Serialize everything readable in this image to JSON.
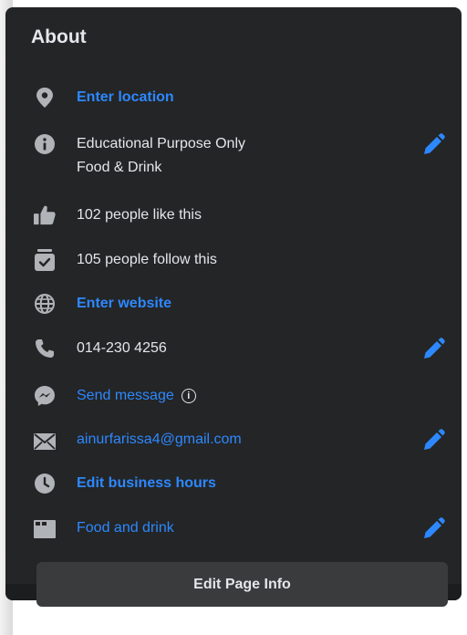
{
  "about": {
    "title": "About",
    "location": "Enter location",
    "category_line1": "Educational Purpose Only",
    "category_line2": "Food & Drink",
    "likes": "102 people like this",
    "follows": "105 people follow this",
    "website": "Enter website",
    "phone": "014-230 4256",
    "message": "Send message",
    "message_info_icon": "i",
    "email": "ainurfarissa4@gmail.com",
    "hours": "Edit business hours",
    "price_category": "Food and drink",
    "edit_button": "Edit Page Info"
  },
  "colors": {
    "card_bg": "#242526",
    "text": "#e4e6eb",
    "link": "#2d88ff",
    "icon": "#b0b3b8",
    "button_bg": "#3a3b3c"
  },
  "icons": [
    "location-pin-icon",
    "info-icon",
    "thumbs-up-icon",
    "follow-icon",
    "globe-icon",
    "phone-icon",
    "messenger-icon",
    "mail-icon",
    "clock-icon",
    "category-icon",
    "pencil-icon"
  ]
}
